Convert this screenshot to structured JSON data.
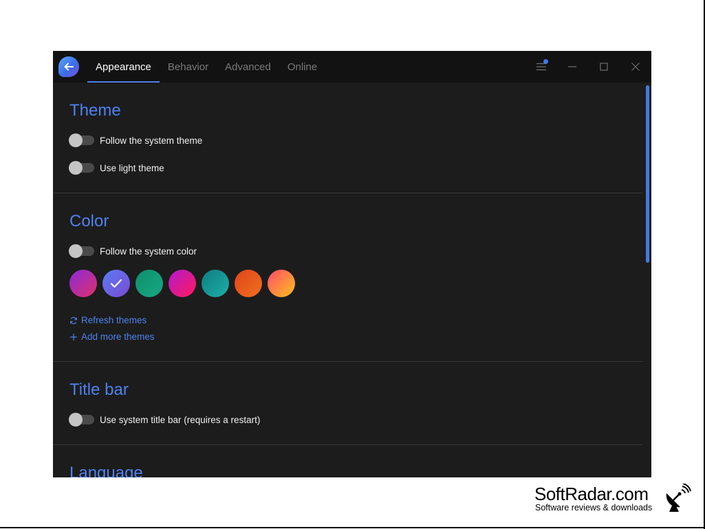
{
  "window": {
    "tabs": [
      {
        "label": "Appearance",
        "active": true
      },
      {
        "label": "Behavior",
        "active": false
      },
      {
        "label": "Advanced",
        "active": false
      },
      {
        "label": "Online",
        "active": false
      }
    ],
    "icons": {
      "back": "arrow-left-icon",
      "menu": "hamburger-icon",
      "minimize": "minimize-icon",
      "maximize": "maximize-icon",
      "close": "close-icon"
    },
    "accent_color": "#4d82ee",
    "background_color": "#1c1c1c"
  },
  "sections": {
    "theme": {
      "title": "Theme",
      "toggles": [
        {
          "label": "Follow the system theme",
          "on": false
        },
        {
          "label": "Use light theme",
          "on": false
        }
      ]
    },
    "color": {
      "title": "Color",
      "toggles": [
        {
          "label": "Follow the system color",
          "on": false
        }
      ],
      "swatches": [
        {
          "from": "#8a2bd8",
          "to": "#e0306a",
          "selected": false
        },
        {
          "from": "#5a7cf0",
          "to": "#7a4ad8",
          "selected": true
        },
        {
          "from": "#0e8f6a",
          "to": "#18a884",
          "selected": false
        },
        {
          "from": "#b21ad0",
          "to": "#ff1a5a",
          "selected": false
        },
        {
          "from": "#0d7c82",
          "to": "#20b0a8",
          "selected": false
        },
        {
          "from": "#e04418",
          "to": "#f07020",
          "selected": false
        },
        {
          "from": "#ff4a6a",
          "to": "#ffc21a",
          "selected": false
        }
      ],
      "refresh_label": "Refresh themes",
      "add_label": "Add more themes"
    },
    "title_bar": {
      "title": "Title bar",
      "toggles": [
        {
          "label": "Use system title bar (requires a restart)",
          "on": false
        }
      ]
    },
    "language": {
      "title": "Language"
    }
  },
  "watermark": {
    "name": "SoftRadar.com",
    "tagline": "Software reviews & downloads"
  }
}
